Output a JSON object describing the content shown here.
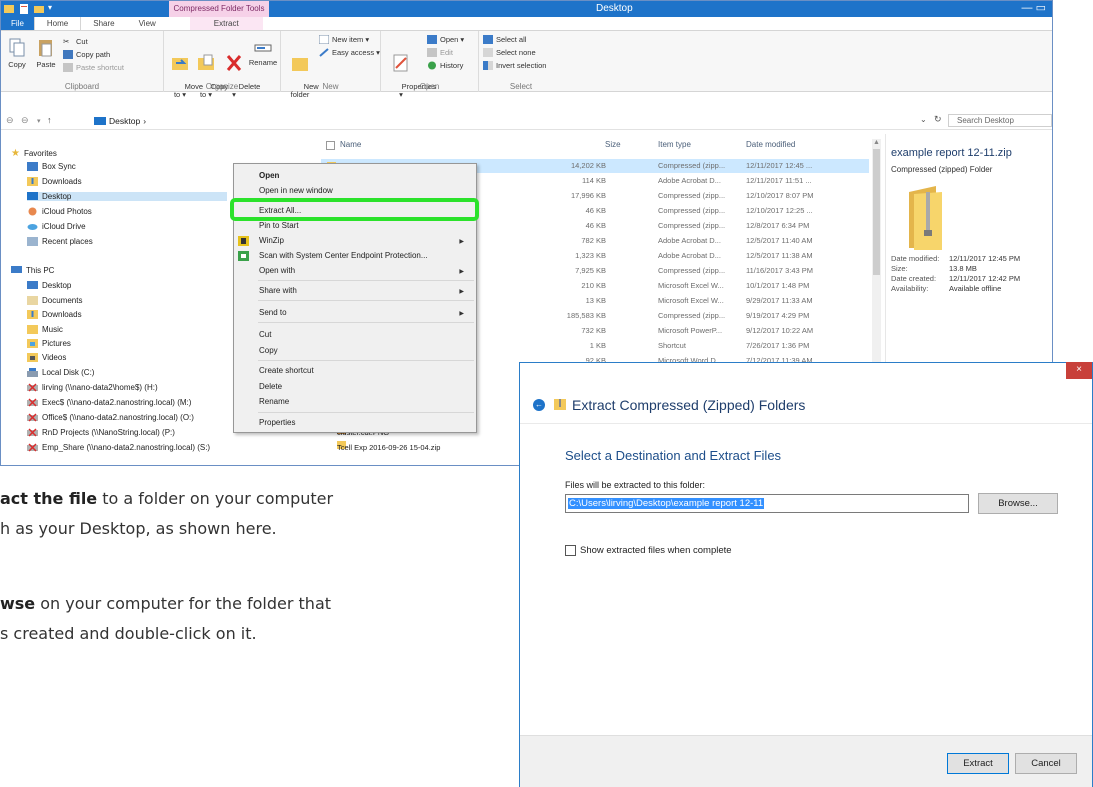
{
  "explorer": {
    "window_title": "Desktop",
    "contextual_tab_title": "Compressed Folder Tools",
    "tabs": [
      "File",
      "Home",
      "Share",
      "View",
      "Extract"
    ],
    "ribbon": {
      "clipboard": {
        "label": "Clipboard",
        "copy": "Copy",
        "paste": "Paste",
        "cut": "Cut",
        "copy_path": "Copy path",
        "paste_shortcut": "Paste shortcut"
      },
      "organize": {
        "label": "Organize",
        "move_to": "Move\nto ▾",
        "copy_to": "Copy\nto ▾",
        "delete": "Delete\n▾",
        "rename": "Rename"
      },
      "new": {
        "label": "New",
        "new_folder": "New\nfolder",
        "new_item": "New item ▾",
        "easy_access": "Easy access ▾"
      },
      "open": {
        "label": "Open",
        "properties": "Properties\n▾",
        "open": "Open ▾",
        "edit": "Edit",
        "history": "History"
      },
      "select": {
        "label": "Select",
        "select_all": "Select all",
        "select_none": "Select none",
        "invert": "Invert selection"
      }
    },
    "address": {
      "path": "Desktop",
      "search_placeholder": "Search Desktop"
    },
    "nav": {
      "favorites": "Favorites",
      "fav_items": [
        "Box Sync",
        "Downloads",
        "Desktop",
        "iCloud Photos",
        "iCloud Drive",
        "Recent places"
      ],
      "this_pc": "This PC",
      "pc_items": [
        "Desktop",
        "Documents",
        "Downloads",
        "Music",
        "Pictures",
        "Videos",
        "Local Disk (C:)",
        "lirving (\\\\nano-data2\\home$) (H:)",
        "Exec$ (\\\\nano-data2.nanostring.local) (M:)",
        "Office$ (\\\\nano-data2.nanostring.local) (O:)",
        "RnD Projects (\\\\NanoString.local) (P:)",
        "Emp_Share (\\\\nano-data2.nanostring.local) (S:)"
      ]
    },
    "columns": {
      "name": "Name",
      "size": "Size",
      "type": "Item type",
      "date": "Date modified"
    },
    "files": [
      {
        "name": "",
        "size": "14,202 KB",
        "type": "Compressed (zipp...",
        "date": "12/11/2017 12:45 ..."
      },
      {
        "name": "",
        "size": "114 KB",
        "type": "Adobe Acrobat D...",
        "date": "12/11/2017 11:51 ..."
      },
      {
        "name": "",
        "size": "17,996 KB",
        "type": "Compressed (zipp...",
        "date": "12/10/2017 8:07 PM"
      },
      {
        "name": "",
        "size": "46 KB",
        "type": "Compressed (zipp...",
        "date": "12/10/2017 12:25 ..."
      },
      {
        "name": "",
        "size": "46 KB",
        "type": "Compressed (zipp...",
        "date": "12/8/2017 6:34 PM"
      },
      {
        "name": "",
        "size": "782 KB",
        "type": "Adobe Acrobat D...",
        "date": "12/5/2017 11:40 AM"
      },
      {
        "name": "",
        "size": "1,323 KB",
        "type": "Adobe Acrobat D...",
        "date": "12/5/2017 11:38 AM"
      },
      {
        "name": "",
        "size": "7,925 KB",
        "type": "Compressed (zipp...",
        "date": "11/16/2017 3:43 PM"
      },
      {
        "name": "",
        "size": "210 KB",
        "type": "Microsoft Excel W...",
        "date": "10/1/2017 1:48 PM"
      },
      {
        "name": "",
        "size": "13 KB",
        "type": "Microsoft Excel W...",
        "date": "9/29/2017 11:33 AM"
      },
      {
        "name": "Jtility.zip",
        "size": "185,583 KB",
        "type": "Compressed (zipp...",
        "date": "9/19/2017 4:29 PM"
      },
      {
        "name": "v4.pptx",
        "size": "732 KB",
        "type": "Microsoft PowerP...",
        "date": "9/12/2017 10:22 AM"
      },
      {
        "name": "",
        "size": "1 KB",
        "type": "Shortcut",
        "date": "7/26/2017 1:36 PM"
      },
      {
        "name": "t.docx",
        "size": "92 KB",
        "type": "Microsoft Word D...",
        "date": "7/12/2017 11:39 AM"
      }
    ],
    "visible_files_below": [
      "cluster.cdt.PNG",
      "Tcell Exp 2016-09-26 15-04.zip"
    ],
    "preview": {
      "title": "example report 12-11.zip",
      "subtitle": "Compressed (zipped) Folder",
      "date_modified_label": "Date modified:",
      "date_modified": "12/11/2017 12:45 PM",
      "size_label": "Size:",
      "size": "13.8 MB",
      "date_created_label": "Date created:",
      "date_created": "12/11/2017 12:42 PM",
      "availability_label": "Availability:",
      "availability": "Available offline"
    },
    "context_menu": {
      "open": "Open",
      "open_new_window": "Open in new window",
      "extract_all": "Extract All...",
      "pin_to_start": "Pin to Start",
      "winzip": "WinZip",
      "scan": "Scan with System Center Endpoint Protection...",
      "open_with": "Open with",
      "share_with": "Share with",
      "send_to": "Send to",
      "cut": "Cut",
      "copy": "Copy",
      "create_shortcut": "Create shortcut",
      "delete": "Delete",
      "rename": "Rename",
      "properties": "Properties"
    }
  },
  "instructions": {
    "line1_bold": "act the file",
    "line1_rest": " to a folder on your computer",
    "line2": "h as your Desktop, as shown here.",
    "line3_bold": "wse",
    "line3_rest": " on your computer for the folder that",
    "line4": "s created and double-click on it."
  },
  "dialog": {
    "title": "Extract Compressed (Zipped) Folders",
    "heading": "Select a Destination and Extract Files",
    "label": "Files will be extracted to this folder:",
    "path_value": "C:\\Users\\lirving\\Desktop\\example report 12-11",
    "browse": "Browse...",
    "checkbox_label": "Show extracted files when complete",
    "extract": "Extract",
    "cancel": "Cancel",
    "close": "×"
  },
  "colors": {
    "accent": "#1e73c9",
    "highlight": "#2be22b",
    "selection": "#cce8ff"
  }
}
